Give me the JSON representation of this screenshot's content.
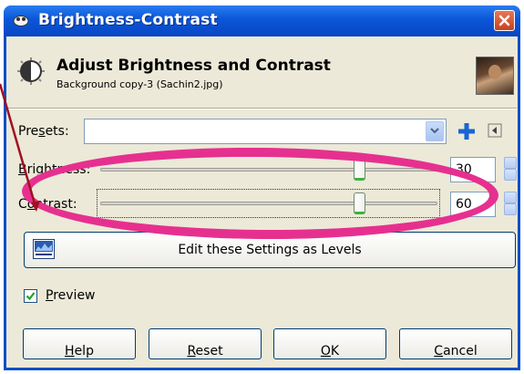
{
  "window": {
    "title": "Brightness-Contrast",
    "close_icon": "close-icon"
  },
  "header": {
    "title": "Adjust Brightness and Contrast",
    "subtitle": "Background copy-3 (Sachin2.jpg)"
  },
  "presets": {
    "label_pre": "Pre",
    "label_mnemonic": "s",
    "label_post": "ets:",
    "value": "",
    "add_icon": "plus-icon",
    "menu_icon": "menu-icon"
  },
  "brightness": {
    "label_pre": "",
    "label_mnemonic": "B",
    "label_post": "rightness:",
    "value": "30",
    "slider_fraction": 0.77
  },
  "contrast": {
    "label_pre": "C",
    "label_mnemonic": "o",
    "label_post": "ntrast:",
    "value": "60",
    "slider_fraction": 0.77
  },
  "levels_button": {
    "label": "Edit these Settings as Levels"
  },
  "preview": {
    "label_mnemonic": "P",
    "label_post": "review",
    "checked": true
  },
  "buttons": {
    "help_mnemonic": "H",
    "help_post": "elp",
    "reset_mnemonic": "R",
    "reset_post": "eset",
    "ok_mnemonic": "O",
    "ok_post": "K",
    "cancel_mnemonic": "C",
    "cancel_post": "ancel"
  },
  "colors": {
    "titlebar": "#0a56d8",
    "annotation": "#e6308f",
    "annotation_line": "#a01020"
  }
}
